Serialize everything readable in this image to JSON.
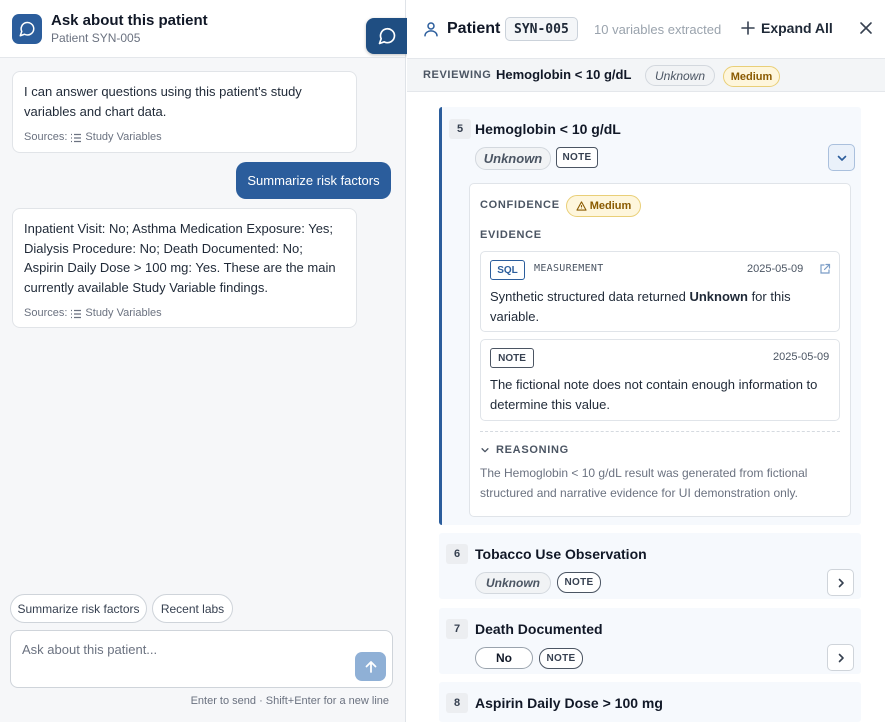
{
  "chat": {
    "title": "Ask about this patient",
    "subtitle": "Patient SYN-005",
    "messages": [
      {
        "text": "I can answer questions using this patient's study variables and chart data.",
        "sources_label": "Sources:",
        "source": "Study Variables"
      },
      {
        "text": "Inpatient Visit: No; Asthma Medication Exposure: Yes; Dialysis Procedure: No; Death Documented: No; Aspirin Daily Dose > 100 mg: Yes. These are the main currently available Study Variable findings.",
        "sources_label": "Sources:",
        "source": "Study Variables"
      }
    ],
    "user_message": "Summarize risk factors",
    "suggestions": [
      "Summarize risk factors",
      "Recent labs"
    ],
    "input_placeholder": "Ask about this patient...",
    "hint": "Enter to send · Shift+Enter for a new line"
  },
  "panel": {
    "title": "Patient",
    "patient_id": "SYN-005",
    "count": "10 variables extracted",
    "expand_label": "Expand All",
    "reviewing": {
      "label": "REVIEWING",
      "name": "Hemoglobin < 10 g/dL",
      "status": "Unknown",
      "confidence": "Medium"
    },
    "variables": [
      {
        "number": "5",
        "name": "Hemoglobin < 10 g/dL",
        "value": "Unknown",
        "tag": "NOTE",
        "confidence_label": "CONFIDENCE",
        "confidence": "Medium",
        "evidence_label": "EVIDENCE",
        "evidence": [
          {
            "type": "SQL",
            "source": "MEASUREMENT",
            "date": "2025-05-09",
            "text_before": "Synthetic structured data returned ",
            "text_bold": "Unknown",
            "text_after": " for this variable."
          },
          {
            "type": "NOTE",
            "date": "2025-05-09",
            "text": "The fictional note does not contain enough information to determine this value."
          }
        ],
        "reasoning_label": "REASONING",
        "reasoning": "The Hemoglobin < 10 g/dL result was generated from fictional structured and narrative evidence for UI demonstration only."
      },
      {
        "number": "6",
        "name": "Tobacco Use Observation",
        "value": "Unknown",
        "tag": "NOTE"
      },
      {
        "number": "7",
        "name": "Death Documented",
        "value": "No",
        "tag": "NOTE"
      },
      {
        "number": "8",
        "name": "Aspirin Daily Dose > 100 mg"
      }
    ]
  },
  "colors": {
    "primary": "#2b5d9c",
    "medium_bg": "#fef6dc",
    "medium_text": "#8a5a00"
  }
}
